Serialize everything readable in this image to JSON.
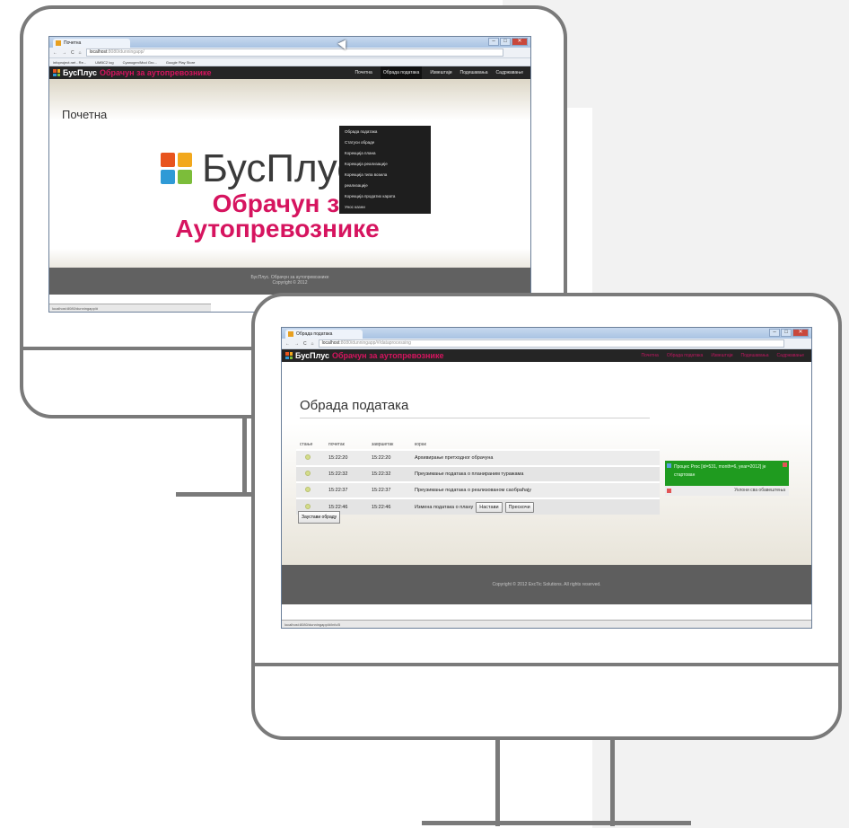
{
  "window_home": {
    "tab_title": "Почетна",
    "url_host": "localhost",
    "url_rest": ":8080/dunningapp/",
    "bookmarks": [
      "infoproject.net - Re...",
      "UMBC2 log",
      "Cyanogen/Mod Gro...",
      "Google Play Store"
    ],
    "app_name": "БусПлус",
    "app_subtitle": "Обрачун за аутопревознике",
    "nav": [
      "Почетна",
      "Обрада података",
      "Извештаји",
      "Подешавања",
      "Садржавање"
    ],
    "dropdown": [
      "Обрада података",
      "Статуси обраде",
      "Корекција плана",
      "Корекција реализације",
      "Корекција типа возила",
      "реализације",
      "Корекција продатих карата",
      "Унос казни"
    ],
    "page_title": "Почетна",
    "logo_name": "БусПлус",
    "logo_line1": "Обрачун за",
    "logo_line2": "Аутопревознике",
    "footer_line1": "БусПлус. Обрачун за аутопревознике",
    "footer_line2": "Copyright © 2012",
    "status_url": "localhost:8080/dunningapp/#"
  },
  "window_processing": {
    "tab_title": "Обрада података",
    "url_host": "localhost",
    "url_rest": ":8080/dunningapp/#/dataprocessing",
    "app_name": "БусПлус",
    "app_subtitle": "Обрачун за аутопревознике",
    "nav": [
      "Почетна",
      "Обрада података",
      "Извештаји",
      "Подешавања",
      "Садржавање"
    ],
    "page_title": "Обрада података",
    "columns": [
      "стање",
      "почетак",
      "завршетак",
      "корак"
    ],
    "rows": [
      {
        "start": "15:22:20",
        "end": "15:22:20",
        "step": "Архивирање претходног обрачуна"
      },
      {
        "start": "15:22:32",
        "end": "15:22:32",
        "step": "Преузимање података о планираним туражама"
      },
      {
        "start": "15:22:37",
        "end": "15:22:37",
        "step": "Преузимање података о реализованом саобраћају"
      },
      {
        "start": "15:22:46",
        "end": "15:22:46",
        "step": "Измена података о плану"
      }
    ],
    "continue_label": "Настави",
    "skip_label": "Прескочи",
    "stop_label": "Заустави обраду",
    "notice_text": "Процес Proc [id=531, month=6, year=2012] је стартован",
    "clear_label": "Уклони сва обавештења",
    "footer": "Copyright © 2012 ExcTic Solutions. All rights reserved.",
    "status_url": "localhost:8080/dunningapp/#/info/5"
  },
  "colors": {
    "brand_magenta": "#d6145f",
    "notice_green": "#1f9b1f",
    "app_bar": "#252525",
    "monitor_frame": "#7a7a7a"
  }
}
